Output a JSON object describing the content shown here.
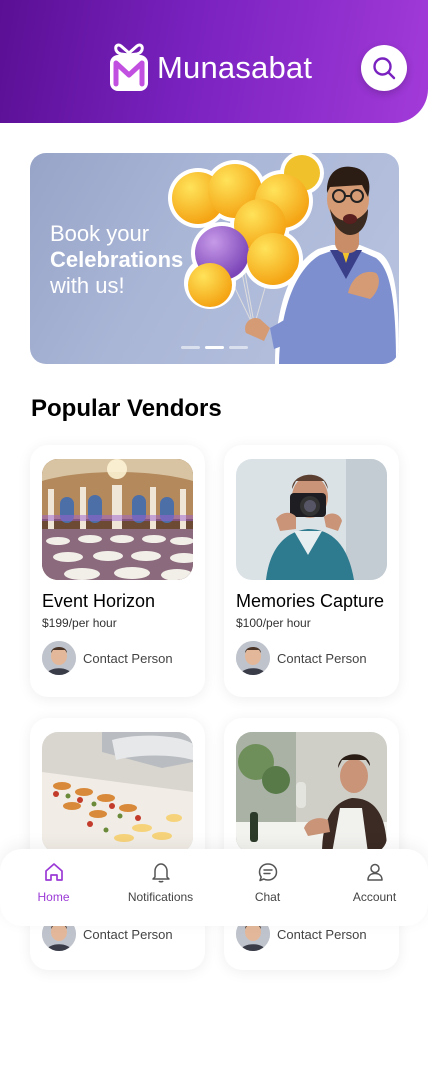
{
  "header": {
    "brand": "Munasabat"
  },
  "banner": {
    "line1": "Book your",
    "line2": "Celebrations",
    "line3": "with us!",
    "slide_count": 3,
    "active_slide": 2
  },
  "section": {
    "title": "Popular Vendors"
  },
  "vendors": [
    {
      "name": "Event Horizon",
      "price": "$199/per hour",
      "contact": "Contact Person"
    },
    {
      "name": "Memories Capture",
      "price": "$100/per hour",
      "contact": "Contact Person"
    },
    {
      "name": "",
      "price": "",
      "contact": "Contact Person"
    },
    {
      "name": "",
      "price": "",
      "contact": "Contact Person"
    }
  ],
  "nav": {
    "items": [
      {
        "label": "Home",
        "icon": "home-icon",
        "active": true
      },
      {
        "label": "Notifications",
        "icon": "bell-icon",
        "active": false
      },
      {
        "label": "Chat",
        "icon": "chat-icon",
        "active": false
      },
      {
        "label": "Account",
        "icon": "user-icon",
        "active": false
      }
    ]
  },
  "colors": {
    "accent": "#9b3ad6",
    "header_start": "#5a0f94",
    "header_end": "#a23ad8"
  }
}
